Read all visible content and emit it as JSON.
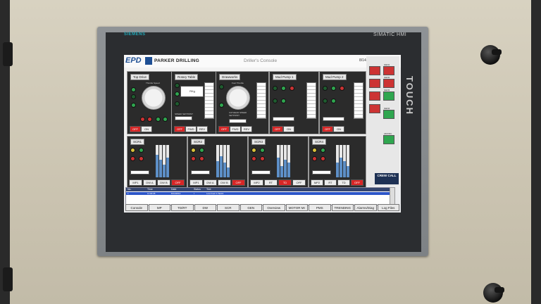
{
  "hardware": {
    "brand": "SIEMENS",
    "model": "SIMATIC HMI",
    "touch_label": "TOUCH"
  },
  "header": {
    "logo": "EPD",
    "company": "PARKER DRILLING",
    "title": "Driller's Console",
    "datetime": "8/14/2014 11:13"
  },
  "drives": [
    {
      "title": "Top Drive",
      "dial_label": "Throttle Speed",
      "buttons": [
        "OFF",
        "ON"
      ]
    },
    {
      "title": "Rotary Table",
      "readout": "RKg",
      "setpoint_label": "SPEED SETPOINT",
      "buttons": [
        "OFF",
        "FWD",
        "REV"
      ]
    },
    {
      "title": "Drawworks",
      "dial_label": "Foot Throttle",
      "setpoint_label": "CATHEAD SPEED SETPOINT",
      "buttons": [
        "OFF",
        "FWD",
        "REV"
      ]
    },
    {
      "title": "Mud Pump 1",
      "buttons": [
        "OFF",
        "ON"
      ]
    },
    {
      "title": "Mud Pump 2",
      "buttons": [
        "OFF",
        "ON"
      ]
    }
  ],
  "scr": [
    {
      "title": "SCR1",
      "buttons": [
        "MP1",
        "DW A",
        "DW B",
        "OFF"
      ]
    },
    {
      "title": "SCR2",
      "buttons": [
        "MP1",
        "DW A",
        "DW B",
        "OFF"
      ]
    },
    {
      "title": "SCR3",
      "buttons": [
        "MP2",
        "RT",
        "TD",
        "OFF"
      ]
    },
    {
      "title": "SCR4",
      "buttons": [
        "MP2",
        "RT",
        "TD",
        "OFF"
      ]
    }
  ],
  "status_column": {
    "labels": [
      "GEN1",
      "GEN2",
      "GEN3",
      "GEN4",
      "240VDC"
    ],
    "crew_call": "CREW CALL"
  },
  "alarms": {
    "columns": [
      "No.",
      "Time",
      "Date",
      "Status",
      "Text"
    ],
    "rows": [
      {
        "no": "1",
        "time": "11:00:35",
        "date": "8/14/2014",
        "status": "I",
        "text": "Low Fuel In Tank1"
      }
    ]
  },
  "nav": [
    "Console",
    "MP",
    "TD/RT",
    "DW",
    "SCR",
    "GEN",
    "Overview",
    "MOTOR MI",
    "PMS",
    "TRENDING",
    "Alarms/Diag",
    "Log Files"
  ],
  "colors": {
    "accent": "#1e4f94",
    "off_red": "#d72626",
    "panel": "#2b2b2b"
  }
}
